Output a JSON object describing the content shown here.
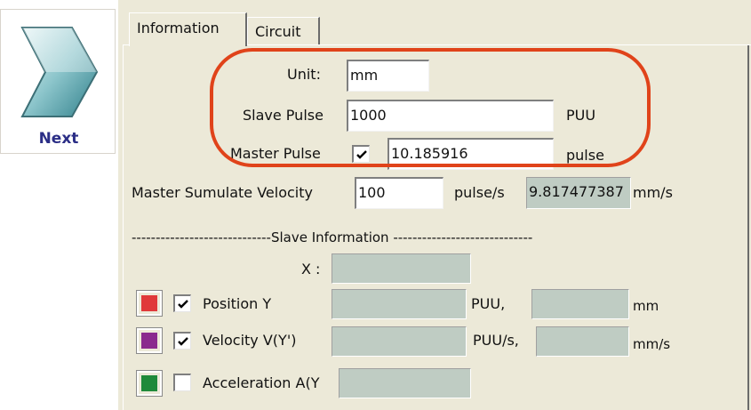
{
  "next_button": {
    "label": "Next",
    "icon": "right-arrow-icon"
  },
  "tabs": [
    {
      "label": "Information",
      "active": true
    },
    {
      "label": "Circuit",
      "active": false
    }
  ],
  "fields": {
    "unit": {
      "label": "Unit:",
      "value": "mm"
    },
    "slave_pulse": {
      "label": "Slave Pulse",
      "value": "1000",
      "unit": "PUU"
    },
    "master_pulse": {
      "label": "Master Pulse",
      "checked": true,
      "value": "10.185916",
      "unit": "pulse"
    },
    "master_velocity": {
      "label": "Master Sumulate Velocity",
      "value": "100",
      "unit": "pulse/s",
      "computed": "9.817477387",
      "computed_unit": "mm/s"
    }
  },
  "slave_section": {
    "divider": "-----------------------------Slave Information -----------------------------",
    "x_label": "X :",
    "x_value": "",
    "rows": [
      {
        "label": "Position Y",
        "checked": true,
        "color": "#e0393a",
        "unit1": "PUU,",
        "unit2": "mm",
        "value1": "",
        "value2": ""
      },
      {
        "label": "Velocity V(Y')",
        "checked": true,
        "color": "#8a2a8e",
        "unit1": "PUU/s,",
        "unit2": "mm/s",
        "value1": "",
        "value2": ""
      },
      {
        "label": "Acceleration A(Y",
        "checked": false,
        "color": "#1f8a3a",
        "value1": ""
      }
    ]
  },
  "colors": {
    "highlight": "#e0431a",
    "panel": "#ece9d8",
    "readonly_field": "#bfccc3",
    "next_text": "#2b2e86"
  }
}
